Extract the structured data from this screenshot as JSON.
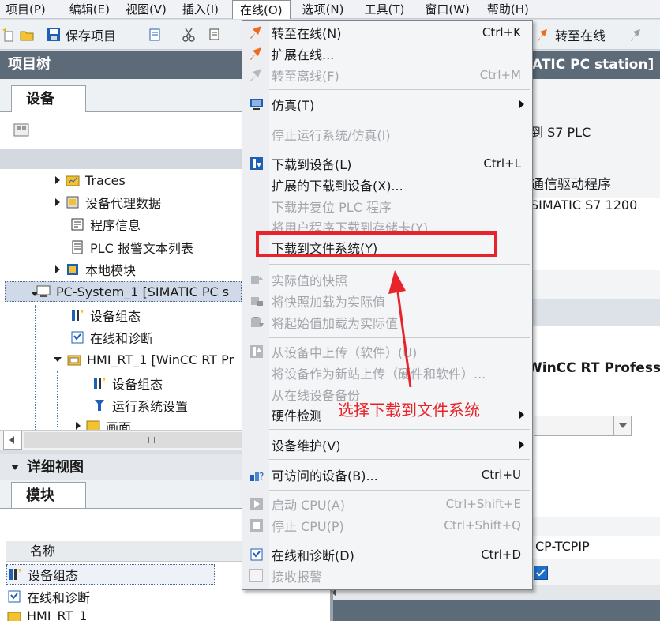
{
  "menubar": {
    "items": [
      "项目(P)",
      "编辑(E)",
      "视图(V)",
      "插入(I)",
      "在线(O)",
      "选项(N)",
      "工具(T)",
      "窗口(W)",
      "帮助(H)"
    ]
  },
  "toolbar": {
    "save_label": "保存项目",
    "go_online_label": "转至在线"
  },
  "tree": {
    "title": "项目树",
    "tab_label": "设备",
    "items": [
      "Traces",
      "设备代理数据",
      "程序信息",
      "PLC 报警文本列表",
      "本地模块",
      "PC-System_1 [SIMATIC PC s",
      "设备组态",
      "在线和诊断",
      "HMI_RT_1 [WinCC RT Pr",
      "设备组态",
      "运行系统设置",
      "画面"
    ]
  },
  "detail": {
    "title": "详细视图",
    "tab_label": "模块",
    "col_name": "名称",
    "rows": [
      "设备组态",
      "在线和诊断",
      "HMI_RT_1"
    ]
  },
  "right_panel": {
    "texts": [
      "ATIC PC station]",
      "到 S7 PLC",
      "通信驱动程序",
      "SIMATIC S7 1200",
      "WinCC RT Professi",
      "CP-TCPIP"
    ]
  },
  "dropdown": {
    "items": [
      {
        "label": "转至在线(N)",
        "shortcut": "Ctrl+K"
      },
      {
        "label": "扩展在线...",
        "shortcut": ""
      },
      {
        "label": "转至离线(F)",
        "shortcut": "Ctrl+M"
      },
      {
        "label": "仿真(T)",
        "shortcut": ""
      },
      {
        "label": "停止运行系统/仿真(I)",
        "shortcut": ""
      },
      {
        "label": "下载到设备(L)",
        "shortcut": "Ctrl+L"
      },
      {
        "label": "扩展的下载到设备(X)...",
        "shortcut": ""
      },
      {
        "label": "下载并复位 PLC 程序",
        "shortcut": ""
      },
      {
        "label": "将用户程序下载到存储卡(Y)",
        "shortcut": ""
      },
      {
        "label": "下载到文件系统(Y)",
        "shortcut": ""
      },
      {
        "label": "实际值的快照",
        "shortcut": ""
      },
      {
        "label": "将快照加载为实际值",
        "shortcut": ""
      },
      {
        "label": "将起始值加载为实际值",
        "shortcut": ""
      },
      {
        "label": "从设备中上传（软件）(U)",
        "shortcut": ""
      },
      {
        "label": "将设备作为新站上传（硬件和软件）...",
        "shortcut": ""
      },
      {
        "label": "从在线设备备份",
        "shortcut": ""
      },
      {
        "label": "硬件检测",
        "shortcut": ""
      },
      {
        "label": "设备维护(V)",
        "shortcut": ""
      },
      {
        "label": "可访问的设备(B)...",
        "shortcut": "Ctrl+U"
      },
      {
        "label": "启动 CPU(A)",
        "shortcut": "Ctrl+Shift+E"
      },
      {
        "label": "停止 CPU(P)",
        "shortcut": "Ctrl+Shift+Q"
      },
      {
        "label": "在线和诊断(D)",
        "shortcut": "Ctrl+D"
      },
      {
        "label": "接收报警",
        "shortcut": ""
      }
    ]
  },
  "annotation": {
    "text": "选择下载到文件系统",
    "color": "#e8242a"
  },
  "colors": {
    "tree_header_bg": "#5d6b79",
    "online_icon": "#f06a1e",
    "highlight": "#e8242a"
  }
}
